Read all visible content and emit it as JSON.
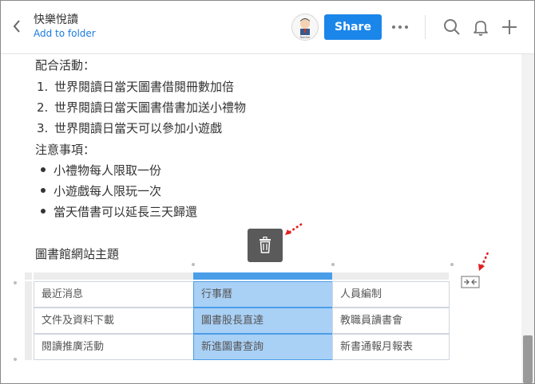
{
  "header": {
    "title": "快樂悅讀",
    "add_to_folder": "Add to folder",
    "share_label": "Share",
    "avatar_caption": "Teacher"
  },
  "doc": {
    "activities_heading": "配合活動：",
    "activities": [
      {
        "num": "1.",
        "text": "世界閱讀日當天圖書借閱冊數加倍"
      },
      {
        "num": "2.",
        "text": "世界閱讀日當天圖書借書加送小禮物"
      },
      {
        "num": "3.",
        "text": "世界閱讀日當天可以參加小遊戲"
      }
    ],
    "notes_heading": "注意事項：",
    "notes": [
      "小禮物每人限取一份",
      "小遊戲每人限玩一次",
      "當天借書可以延長三天歸還"
    ],
    "table_title": "圖書館網站主題"
  },
  "table": {
    "rows": [
      [
        "最近消息",
        "行事曆",
        "人員編制"
      ],
      [
        "文件及資料下載",
        "圖書股長直達",
        "教職員讀書會"
      ],
      [
        "閱讀推廣活動",
        "新進圖書查詢",
        "新書通報月報表"
      ]
    ],
    "selected_column": 1
  },
  "colors": {
    "accent": "#1b86ea",
    "link": "#1b7be0",
    "selection": "#a9d0f5",
    "annotation_arrow": "#e02020"
  },
  "icons": [
    "back-chevron-icon",
    "more-dots-icon",
    "search-icon",
    "bell-icon",
    "plus-icon",
    "trash-icon",
    "fit-width-icon"
  ]
}
